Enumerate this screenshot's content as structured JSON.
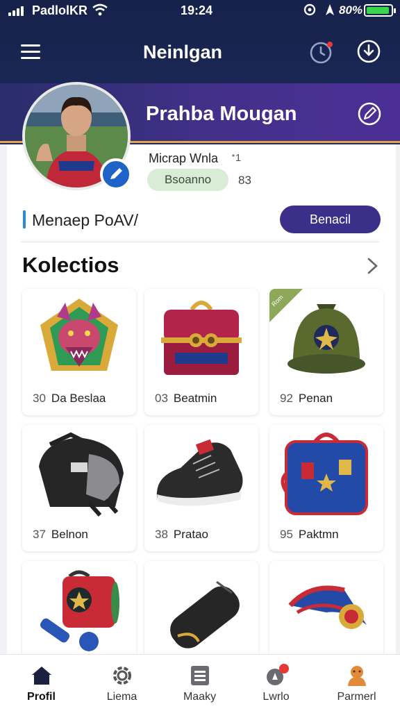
{
  "status_bar": {
    "carrier": "PadlolKR",
    "time": "19:24",
    "battery": "80%",
    "battery_level": 0.95
  },
  "header": {
    "title": "Neinlgan",
    "menu_icon": "hamburger-icon",
    "alert_icon": "clock-alert-icon",
    "download_icon": "download-icon"
  },
  "profile": {
    "name": "Prahba Mougan",
    "edit_icon": "edit-icon",
    "subtitle": "Micrap Wnla",
    "subtitle_mark": "ᐩ1",
    "tag": "Bsoanno",
    "tag_count": "83",
    "manage_label": "Menaep PoAV/",
    "action_button": "Benacil"
  },
  "collection": {
    "title": "Kolectios",
    "items": [
      {
        "num": "30",
        "name": "Da Beslaa",
        "icon": "dragon-emblem-icon"
      },
      {
        "num": "03",
        "name": "Beatmin",
        "icon": "treasure-chest-icon"
      },
      {
        "num": "92",
        "name": "Penan",
        "icon": "military-helmet-icon",
        "ribbon": "Rom"
      },
      {
        "num": "37",
        "name": "Belnon",
        "icon": "backpack-icon"
      },
      {
        "num": "38",
        "name": "Pratao",
        "icon": "sneaker-icon"
      },
      {
        "num": "95",
        "name": "Paktmn",
        "icon": "travel-case-icon"
      },
      {
        "num": "",
        "name": "",
        "icon": "kit-bag-icon"
      },
      {
        "num": "",
        "name": "",
        "icon": "black-case-icon"
      },
      {
        "num": "",
        "name": "",
        "icon": "medal-ribbon-icon"
      }
    ]
  },
  "bottom_nav": [
    {
      "label": "Profil",
      "icon": "home-icon",
      "active": true
    },
    {
      "label": "Liema",
      "icon": "settings-icon",
      "active": false
    },
    {
      "label": "Maaky",
      "icon": "document-icon",
      "active": false
    },
    {
      "label": "Lwrlo",
      "icon": "notification-icon",
      "active": false
    },
    {
      "label": "Parmerl",
      "icon": "avatar-icon",
      "active": false
    }
  ],
  "colors": {
    "header_bg": "#16224a",
    "accent_purple": "#3b2f8a",
    "accent_orange": "#e3a34a",
    "pill_green": "#d8ecd6",
    "notification_red": "#e53935"
  }
}
